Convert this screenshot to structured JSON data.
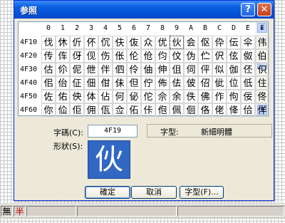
{
  "window": {
    "title": "参照",
    "help_glyph": "?",
    "close_glyph": "✕"
  },
  "grid": {
    "columns": [
      "0",
      "1",
      "2",
      "3",
      "4",
      "5",
      "6",
      "7",
      "8",
      "9",
      "A",
      "B",
      "C",
      "D",
      "E",
      "F"
    ],
    "rows": [
      {
        "code": "4F10",
        "chars": [
          "伐",
          "休",
          "伒",
          "伓",
          "伔",
          "伕",
          "伖",
          "众",
          "优",
          "伙",
          "会",
          "伛",
          "伜",
          "伝",
          "伞",
          "伟"
        ]
      },
      {
        "code": "4F20",
        "chars": [
          "传",
          "伡",
          "伢",
          "伣",
          "伤",
          "伥",
          "伦",
          "伧",
          "伨",
          "伩",
          "伪",
          "伫",
          "伬",
          "伭",
          "伮",
          "伯"
        ]
      },
      {
        "code": "4F30",
        "chars": [
          "估",
          "伱",
          "伲",
          "伳",
          "伴",
          "伵",
          "伶",
          "伷",
          "伸",
          "伹",
          "伺",
          "伻",
          "似",
          "伽",
          "伾",
          "伿"
        ]
      },
      {
        "code": "4F40",
        "chars": [
          "佀",
          "佁",
          "佂",
          "佃",
          "佄",
          "佅",
          "但",
          "佇",
          "佈",
          "佉",
          "佊",
          "佋",
          "佌",
          "位",
          "低",
          "住"
        ]
      },
      {
        "code": "4F50",
        "chars": [
          "佐",
          "佑",
          "佒",
          "体",
          "佔",
          "何",
          "佖",
          "佗",
          "佘",
          "余",
          "佚",
          "佛",
          "作",
          "佝",
          "佞",
          "佟"
        ]
      },
      {
        "code": "4F60",
        "chars": [
          "你",
          "佡",
          "佢",
          "佣",
          "佤",
          "佥",
          "佦",
          "佧",
          "佨",
          "佩",
          "佪",
          "佫",
          "佬",
          "佭",
          "佮",
          "佯"
        ]
      }
    ],
    "selected": {
      "row": 0,
      "col": 9
    },
    "scroll_up_glyph": "▲",
    "scroll_down_glyph": "▼"
  },
  "details": {
    "code_label": "字碼(C):",
    "code_value": "4F19",
    "font_label": "字型:",
    "font_value": "新細明體",
    "shape_label": "形狀(S):",
    "preview_char": "伙"
  },
  "buttons": {
    "ok": "確定",
    "cancel": "取消",
    "font": "字型(F)..."
  },
  "statusbar": {
    "cell1": "無",
    "cell2": "半"
  },
  "colors": {
    "title_bar": "#0a5fe0",
    "dialog_bg": "#ece9d8",
    "preview_bg": "#3168c4",
    "accent_red": "#c00000"
  }
}
